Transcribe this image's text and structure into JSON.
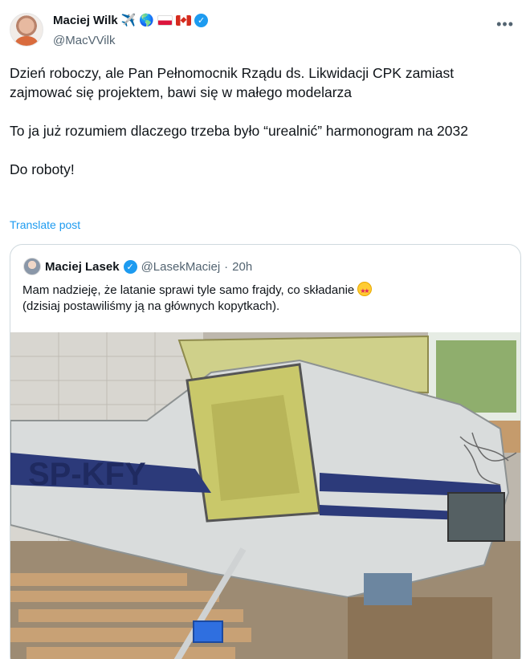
{
  "tweet": {
    "author": {
      "display_name": "Maciej Wilk",
      "name_emojis": [
        "✈️",
        "🌎"
      ],
      "flags": [
        "poland-flag",
        "canada-flag"
      ],
      "verified": true,
      "handle": "@MacVVilk"
    },
    "more_icon": "more-dots-icon",
    "paragraphs": [
      "Dzień roboczy, ale Pan Pełnomocnik Rządu ds.  Likwidacji CPK zamiast zajmować się projektem, bawi się w małego modelarza",
      "To ja już rozumiem dlaczego trzeba było “urealnić” harmonogram na 2032",
      "Do roboty!"
    ],
    "translate_label": "Translate post"
  },
  "quote": {
    "author": {
      "display_name": "Maciej Lasek",
      "verified": true,
      "handle": "@LasekMaciej",
      "separator": "·",
      "time": "20h"
    },
    "text_line1": "Mam nadzieję, że latanie sprawi tyle samo frajdy, co składanie",
    "text_emoji": "star-struck-emoji",
    "text_line2": "(dzisiaj postawiliśmy ją na głównych kopytkach).",
    "image": {
      "subject": "partially assembled small aircraft fuselage in a workshop",
      "registration_partial": "SP-KFY"
    }
  },
  "colors": {
    "accent": "#1d9bf0",
    "secondary_text": "#536471",
    "border": "#cfd9de",
    "text": "#0f1419"
  }
}
